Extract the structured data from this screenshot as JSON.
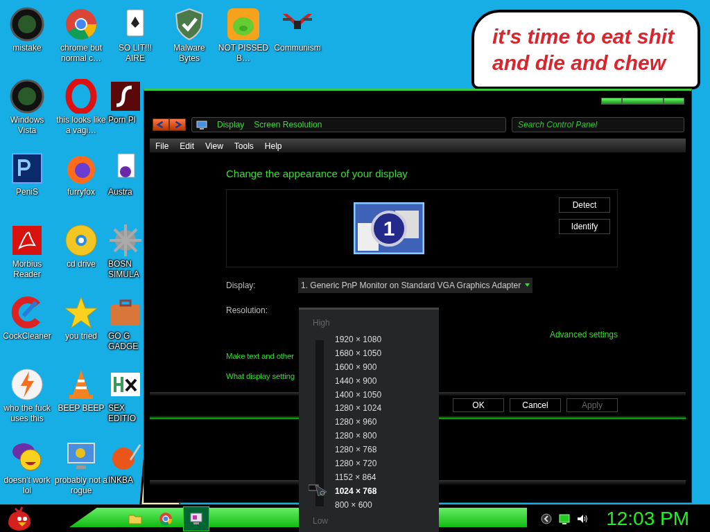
{
  "icon_rows": [
    [
      {
        "kind": "dark-disc",
        "label": "mistake"
      },
      {
        "kind": "browser",
        "label": "chrome but normal c…"
      },
      {
        "kind": "card",
        "label": "SO LIT!!! AIRE"
      },
      {
        "kind": "shield",
        "label": "Malware Bytes"
      },
      {
        "kind": "pig-tile",
        "label": "NOT PISSED B…"
      },
      {
        "kind": "emblem",
        "label": "Communism"
      }
    ],
    [
      {
        "kind": "dark-disc",
        "label": "Windows Vista"
      },
      {
        "kind": "red-ring",
        "label": "this looks like a vagi…"
      },
      {
        "kind": "flash-tile",
        "label": "Porn Pl"
      }
    ],
    [
      {
        "kind": "ps-tile",
        "label": "PeniS"
      },
      {
        "kind": "fox",
        "label": "furryfox"
      },
      {
        "kind": "spider-card",
        "label": "Austra"
      }
    ],
    [
      {
        "kind": "pdf-tile",
        "label": "Morbius Reader"
      },
      {
        "kind": "gold-disc",
        "label": "cd drive"
      },
      {
        "kind": "mine",
        "label": "BOSN SIMULA"
      }
    ],
    [
      {
        "kind": "cleaner",
        "label": "CockCleaner"
      },
      {
        "kind": "star",
        "label": "you tried"
      },
      {
        "kind": "case",
        "label": "GO G GADGE"
      }
    ],
    [
      {
        "kind": "bolt",
        "label": "who the fuck uses this"
      },
      {
        "kind": "cone",
        "label": "BEEP BEEP"
      },
      {
        "kind": "hx-tile",
        "label": "SEX EDITIO"
      }
    ],
    [
      {
        "kind": "smiley",
        "label": "doesn't work lol"
      },
      {
        "kind": "monitor",
        "label": "probably not a rogue"
      },
      {
        "kind": "ball",
        "label": "INKBA"
      }
    ]
  ],
  "speech_bubble": {
    "lines": [
      "it's time to eat shit",
      "and die and chew"
    ]
  },
  "window": {
    "breadcrumb": [
      "Display",
      "Screen Resolution"
    ],
    "search": {
      "placeholder": "Search Control Panel"
    },
    "menu": [
      "File",
      "Edit",
      "View",
      "Tools",
      "Help"
    ],
    "heading": "Change the appearance of your display",
    "monitor_number": "1",
    "side_buttons": [
      "Detect",
      "Identify"
    ],
    "display_label": "Display:",
    "display_value": "1. Generic PnP Monitor on Standard VGA Graphics Adapter",
    "resolution_label": "Resolution:",
    "advanced_link": "Advanced settings",
    "links": [
      "Make text and other",
      "What display setting"
    ],
    "buttons": [
      {
        "label": "OK",
        "disabled": false
      },
      {
        "label": "Cancel",
        "disabled": false
      },
      {
        "label": "Apply",
        "disabled": true
      }
    ],
    "resolution_popup": {
      "high": "High",
      "low": "Low",
      "level": 0.083,
      "options": [
        {
          "label": "1920 × 1080",
          "selected": false
        },
        {
          "label": "1680 × 1050",
          "selected": false
        },
        {
          "label": "1600 × 900",
          "selected": false
        },
        {
          "label": "1440 × 900",
          "selected": false
        },
        {
          "label": "1400 × 1050",
          "selected": false
        },
        {
          "label": "1280 × 1024",
          "selected": false
        },
        {
          "label": "1280 × 960",
          "selected": false
        },
        {
          "label": "1280 × 800",
          "selected": false
        },
        {
          "label": "1280 × 768",
          "selected": false
        },
        {
          "label": "1280 × 720",
          "selected": false
        },
        {
          "label": "1152 × 864",
          "selected": false
        },
        {
          "label": "1024 × 768",
          "selected": true
        },
        {
          "label": "800 × 600",
          "selected": false
        }
      ]
    }
  },
  "taskbar": {
    "apps": [
      {
        "kind": "folder",
        "selected": false
      },
      {
        "kind": "browser",
        "selected": false
      },
      {
        "kind": "control-panel",
        "selected": true
      }
    ],
    "clock": "12:03 PM"
  }
}
